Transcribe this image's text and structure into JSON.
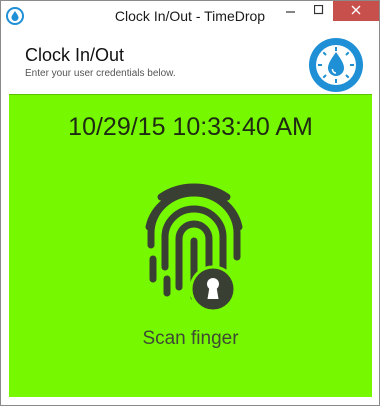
{
  "window": {
    "title": "Clock In/Out - TimeDrop",
    "icons": {
      "app": "water-drop-icon",
      "minimize": "minimize-icon",
      "maximize": "maximize-icon",
      "close": "close-icon"
    }
  },
  "header": {
    "title": "Clock In/Out",
    "subtitle": "Enter your user credentials below.",
    "logo_icon": "timedrop-logo-icon"
  },
  "main": {
    "datetime": "10/29/15 10:33:40 AM",
    "fingerprint_icon": "fingerprint-icon",
    "lock_icon": "keyhole-lock-icon",
    "scan_label": "Scan finger"
  },
  "colors": {
    "main_background": "#76f900",
    "fingerprint": "#3a3f34",
    "logo_blue": "#1f8fd6",
    "close_button": "#c7504c"
  }
}
